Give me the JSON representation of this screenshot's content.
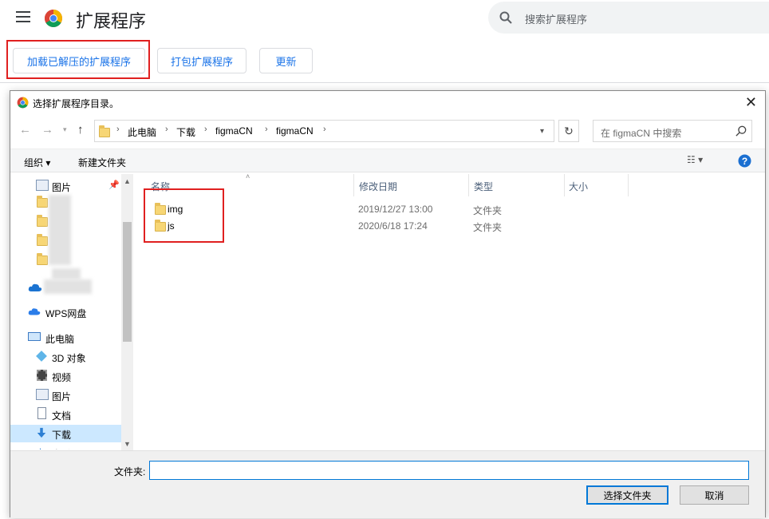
{
  "header": {
    "menu_icon": "hamburger-icon",
    "title": "扩展程序",
    "search_placeholder": "搜索扩展程序"
  },
  "toolbar": {
    "load_unpacked": "加载已解压的扩展程序",
    "pack": "打包扩展程序",
    "update": "更新"
  },
  "dialog": {
    "title": "选择扩展程序目录。",
    "address": [
      "此电脑",
      "下载",
      "figmaCN",
      "figmaCN"
    ],
    "search_placeholder": "在 figmaCN 中搜索",
    "organize": "组织",
    "new_folder": "新建文件夹",
    "nav": {
      "quick_pictures": "图片",
      "wps": "WPS网盘",
      "this_pc": "此电脑",
      "objects3d": "3D 对象",
      "videos": "视频",
      "pictures": "图片",
      "documents": "文档",
      "downloads": "下载",
      "music": "音乐"
    },
    "columns": {
      "name": "名称",
      "date": "修改日期",
      "type": "类型",
      "size": "大小"
    },
    "files": [
      {
        "name": "img",
        "date": "2019/12/27 13:00",
        "type": "文件夹"
      },
      {
        "name": "js",
        "date": "2020/6/18 17:24",
        "type": "文件夹"
      }
    ],
    "folder_label": "文件夹:",
    "folder_value": "",
    "select_button": "选择文件夹",
    "cancel_button": "取消"
  },
  "colors": {
    "accent": "#1a73e8",
    "highlight": "#e02020",
    "selection": "#cce8ff"
  }
}
